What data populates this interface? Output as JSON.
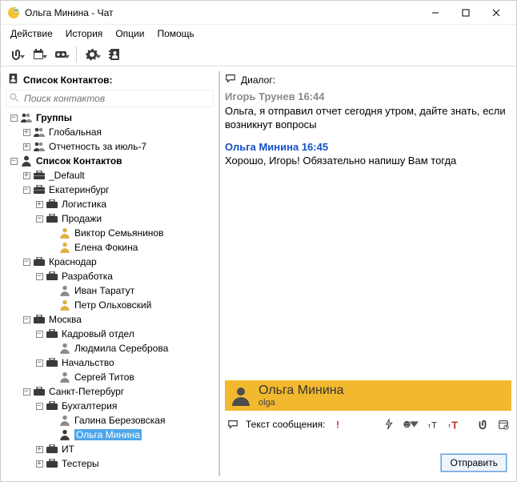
{
  "window": {
    "title": "Ольга Минина - Чат"
  },
  "menu": {
    "action": "Действие",
    "history": "История",
    "options": "Опции",
    "help": "Помощь"
  },
  "sidebar": {
    "header": "Список Контактов:",
    "search_placeholder": "Поиск контактов",
    "groups_root": "Группы",
    "groups": {
      "global": "Глобальная",
      "report": "Отчетность за июль-7"
    },
    "contacts_root": "Список Контактов",
    "offices": {
      "default": "_Default",
      "ekb": {
        "name": "Екатеринбург",
        "logistics": "Логистика",
        "sales": "Продажи",
        "people": {
          "semyaninov": "Виктор Семьянинов",
          "fokina": "Елена Фокина"
        }
      },
      "krasnodar": {
        "name": "Краснодар",
        "dev": "Разработка",
        "people": {
          "taratut": "Иван Таратут",
          "olkhovsky": "Петр Ольховский"
        }
      },
      "moscow": {
        "name": "Москва",
        "hr": "Кадровый отдел",
        "leadership": "Начальство",
        "people": {
          "serebrova": "Людмила Сереброва",
          "titov": "Сергей Титов"
        }
      },
      "spb": {
        "name": "Санкт-Петербург",
        "accounting": "Бухгалтерия",
        "it": "ИТ",
        "testers": "Тестеры",
        "people": {
          "berezovskaya": "Галина Березовская",
          "minina": "Ольга Минина"
        }
      }
    }
  },
  "chat": {
    "dialog_label": "Диалог:",
    "messages": [
      {
        "from": "Игорь Трунев",
        "time": "16:44",
        "kind": "other",
        "text": "Ольга, я отправил отчет сегодня утром, дайте знать, если возникнут вопросы"
      },
      {
        "from": "Ольга Минина",
        "time": "16:45",
        "kind": "self",
        "text": "Хорошо, Игорь! Обязательно напишу Вам тогда"
      }
    ],
    "recipient": {
      "name": "Ольга Минина",
      "login": "olga"
    },
    "compose_label": "Текст сообщения:",
    "send": "Отправить"
  }
}
